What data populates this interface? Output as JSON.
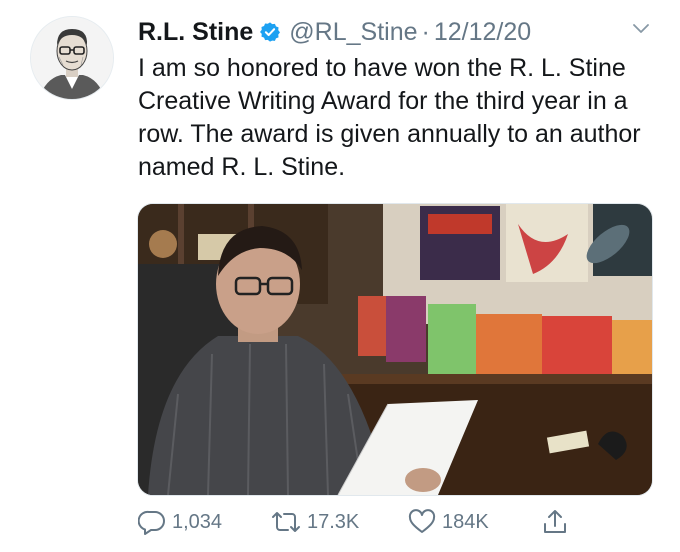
{
  "tweet": {
    "author": {
      "display_name": "R.L. Stine",
      "handle": "@RL_Stine",
      "verified": true,
      "avatar_icon": "portrait-avatar"
    },
    "separator": "·",
    "date": "12/12/20",
    "text": "I am so honored to have won the R. L. Stine Creative Writing Award for the third year in a row. The award is given annually to an author named R. L. Stine.",
    "media": {
      "kind": "photo"
    },
    "actions": {
      "reply_count": "1,034",
      "retweet_count": "17.3K",
      "like_count": "184K"
    }
  },
  "colors": {
    "text": "#14171a",
    "secondary": "#657786",
    "verified_blue": "#1da1f2"
  }
}
